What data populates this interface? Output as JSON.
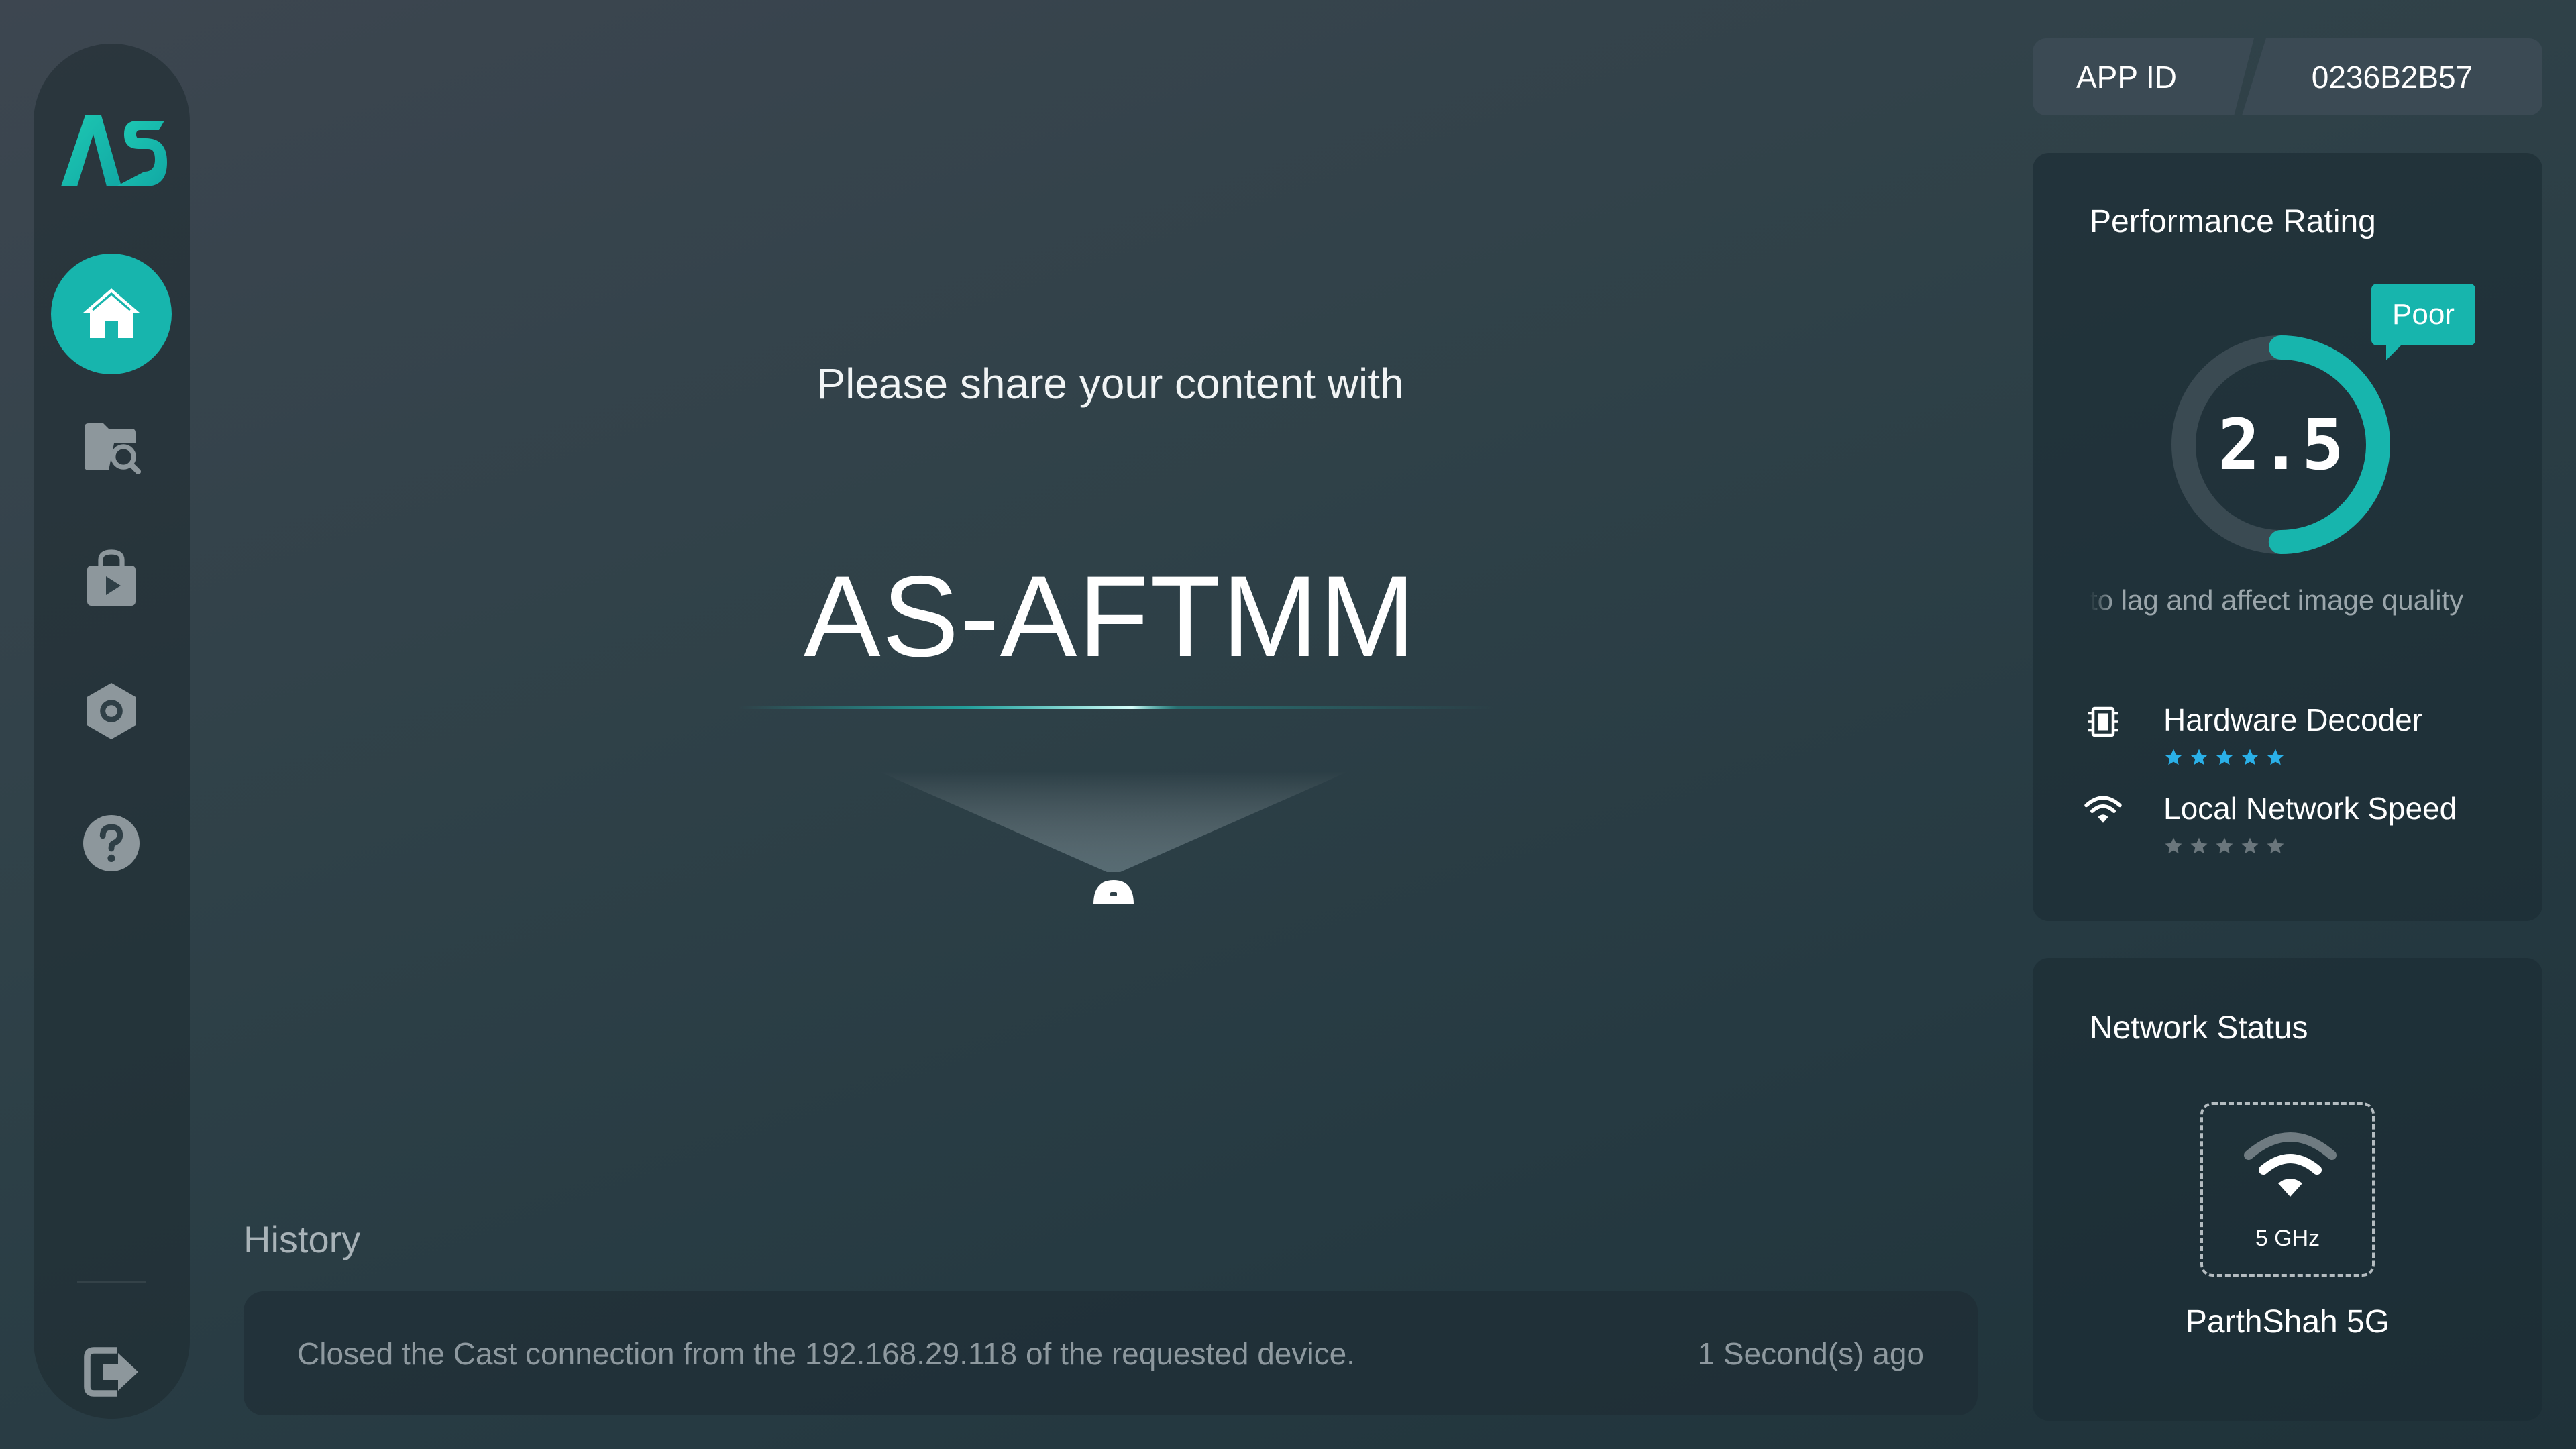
{
  "app": {
    "logo_text": "AS"
  },
  "sidebar": {
    "items": [
      {
        "name": "home",
        "icon": "home-icon",
        "active": true
      },
      {
        "name": "files",
        "icon": "folder-search-icon",
        "active": false
      },
      {
        "name": "store",
        "icon": "video-bag-icon",
        "active": false
      },
      {
        "name": "settings",
        "icon": "gear-icon",
        "active": false
      },
      {
        "name": "help",
        "icon": "help-icon",
        "active": false
      }
    ],
    "exit_icon": "exit-icon"
  },
  "main": {
    "prompt": "Please share your content with",
    "device_name": "AS-AFTMM"
  },
  "history": {
    "title": "History",
    "items": [
      {
        "message": "Closed the Cast connection from the 192.168.29.118 of the requested device.",
        "time": "1 Second(s) ago"
      }
    ]
  },
  "app_id": {
    "label": "APP ID",
    "value": "0236B2B57"
  },
  "performance": {
    "title": "Performance Rating",
    "score": "2.5",
    "score_fraction": 0.5,
    "badge": "Poor",
    "note": "to lag and affect image quality",
    "metrics": [
      {
        "label": "Hardware Decoder",
        "icon": "chip-icon",
        "stars": 5,
        "max": 5,
        "color": "#2ab0e8"
      },
      {
        "label": "Local Network Speed",
        "icon": "wifi-icon",
        "stars": 0,
        "max": 5,
        "color": "#2ab0e8"
      }
    ]
  },
  "network": {
    "title": "Network Status",
    "band": "5 GHz",
    "ssid": "ParthShah 5G"
  },
  "colors": {
    "accent": "#17b5ad",
    "star_active": "#2ab0e8",
    "star_inactive": "#6a767c"
  }
}
